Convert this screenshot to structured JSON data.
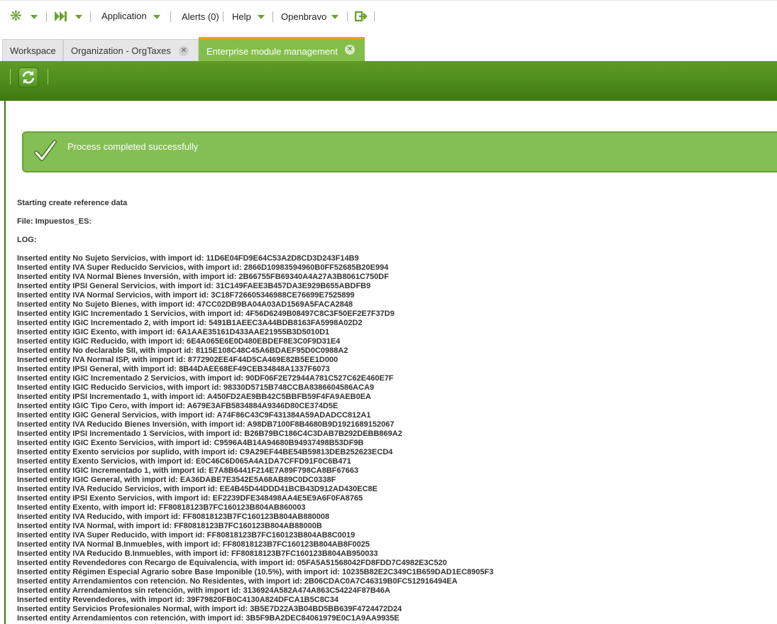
{
  "nav": {
    "application": "Application",
    "alerts": "Alerts (0)",
    "help": "Help",
    "user": "Openbravo"
  },
  "tabs": [
    {
      "label": "Workspace"
    },
    {
      "label": "Organization - OrgTaxes"
    },
    {
      "label": "Enterprise module management"
    }
  ],
  "message": {
    "text": "Process completed successfully"
  },
  "log": {
    "title": "Starting create reference data",
    "file": "File: Impuestos_ES:",
    "label": "LOG:",
    "lines": [
      "Inserted entity No Sujeto Servicios, with import id: 11D6E04FD9E64C53A2D8CD3D243F14B9",
      "Inserted entity IVA Super Reducido Servicios, with import id: 2866D10983594960B0FF52685B20E994",
      "Inserted entity IVA Normal Bienes Inversión, with import id: 2B66755FB69340A4A27A3B8061C750DF",
      "Inserted entity IPSI General Servicios, with import id: 31C149FAEE3B457DA3E929B655ABDFB9",
      "Inserted entity IVA Normal Servicios, with import id: 3C18F726605346988CE76699E7525899",
      "Inserted entity No Sujeto Bienes, with import id: 47CC02DB9BA04A03AD1569A5FACA2848",
      "Inserted entity IGIC Incrementado 1 Servicios, with import id: 4F56D6249B08497C8C3F50EF2E7F37D9",
      "Inserted entity IGIC Incrementado 2, with import id: 5491B1AEEC3A44BDB8163FA5998A02D2",
      "Inserted entity IGIC Exento, with import id: 6A1AAE35161D433AAE21955B3D5010D1",
      "Inserted entity IGIC Reducido, with import id: 6E4A065E6E0D480EBDEF8E3C0F9D31E4",
      "Inserted entity No declarable SII, with import id: 8115E108C48C45A6BDAEF95D0C0988A2",
      "Inserted entity IVA Normal ISP, with import id: 8772902EE4F44D5CA469E82B5EE1D000",
      "Inserted entity IPSI General, with import id: 8B44DAEE68EF49CEB34848A1337F6073",
      "Inserted entity IGIC Incrementado 2 Servicios, with import id: 90DF06F2E72944A781C527C62E460E7F",
      "Inserted entity IGIC Reducido Servicios, with import id: 98330D5715B748CCBA8386604586ACA9",
      "Inserted entity IPSI Incrementado 1, with import id: A450FD2AE9BB42C5BBFB59F4FA9AEB0EA",
      "Inserted entity IGIC Tipo Cero, with import id: A679E3AFB5834884A9346D80CE374D5E",
      "Inserted entity IGIC General Servicios, with import id: A74F86C43C9F431384A59ADADCC812A1",
      "Inserted entity IVA Reducido Bienes Inversión, with import id: A98DB7100F8B4680B9D1921689152067",
      "Inserted entity IPSI Incrementado 1 Servicios, with import id: B26B79BC186C4C3DAB7B292DEBB869A2",
      "Inserted entity IGIC Exento Servicios, with import id: C9596A4B14A94680B94937498B53DF9B",
      "Inserted entity Exento servicios por suplido, with import id: C9A29EF44BE54B59813DEB252623ECD4",
      "Inserted entity Exento Servicios, with import id: E0C46C6D065A4A1DA7CFFD91F0C6B471",
      "Inserted entity IGIC Incrementado 1, with import id: E7A8B6441F214E7A89F798CA8BF67663",
      "Inserted entity IGIC General, with import id: EA36DABE7E3542E5A68AB89C0DC0338F",
      "Inserted entity IVA Reducido Servicios, with import id: EE4B45D44DDD41BCB43D912AD430EC8E",
      "Inserted entity IPSI Exento Servicios, with import id: EF2239DFE348498AA4E5E9A6F0FA8765",
      "Inserted entity Exento, with import id: FF80818123B7FC160123B804AB860003",
      "Inserted entity IVA Reducido, with import id: FF80818123B7FC160123B804AB880008",
      "Inserted entity IVA Normal, with import id: FF80818123B7FC160123B804AB88000B",
      "Inserted entity IVA Super Reducido, with import id: FF80818123B7FC160123B804AB8C0019",
      "Inserted entity IVA Normal B.Inmuebles, with import id: FF80818123B7FC160123B804AB8F0025",
      "Inserted entity IVA Reducido B.Inmuebles, with import id: FF80818123B7FC160123B804AB950033",
      "Inserted entity Revendedores con Recargo de Equivalencia, with import id: 05FA5A51568042FD8FDD7C4982E3C520",
      "Inserted entity Régimen Especial Agrario sobre Base Imponible (10.5%), with import id: 10235B82E2C349C1B659DAD1EC8905F3",
      "Inserted entity Arrendamientos con retención. No Residentes, with import id: 2B06CDAC0A7C46319B0FC512916494EA",
      "Inserted entity Arrendamientos sin retención, with import id: 3136924A582A474A863C54224F87B46A",
      "Inserted entity Revendedores, with import id: 39F79820FB0C4130A824DFCA1B5C8C34",
      "Inserted entity Servicios Profesionales Normal, with import id: 3B5E7D22A3B04BD5BB639F4724472D24",
      "Inserted entity Arrendamientos con retención, with import id: 3B5F9BA2DEC84061979E0C1A9AA9935E"
    ]
  },
  "colors": {
    "accent": "#6aa231",
    "toolbar": "#4d8b1b",
    "message_bg": "#84bf55",
    "tab_active": "#84be4a",
    "tab_active_top": "#f0a020"
  }
}
